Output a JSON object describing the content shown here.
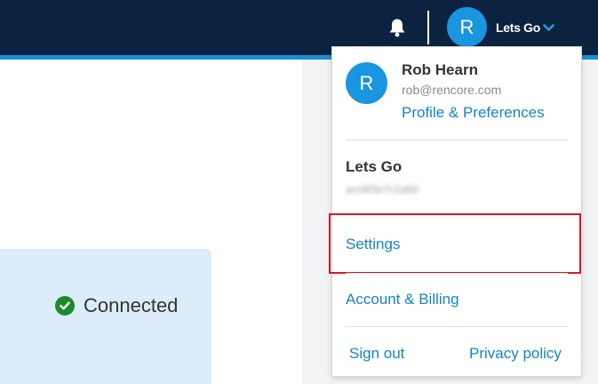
{
  "colors": {
    "header_bg": "#0b2340",
    "header_accent": "#1a8fd8",
    "avatar_bg": "#1a95e0",
    "link": "#1683c9",
    "highlight_border": "#d7192a",
    "connected_check": "#1d8a2e",
    "card_bg": "#dcedf9"
  },
  "header": {
    "notifications_icon": "bell-icon",
    "avatar_initial": "R",
    "account_label": "Lets Go",
    "dropdown_icon": "chevron-down-icon"
  },
  "status": {
    "icon": "check-circle-icon",
    "label": "Connected"
  },
  "dropdown": {
    "avatar_initial": "R",
    "user_name": "Rob Hearn",
    "user_email": "rob@rencore.com",
    "profile_link": "Profile & Preferences",
    "account_name": "Lets Go",
    "settings_link": "Settings",
    "billing_link": "Account & Billing",
    "sign_out_link": "Sign out",
    "privacy_link": "Privacy policy"
  }
}
